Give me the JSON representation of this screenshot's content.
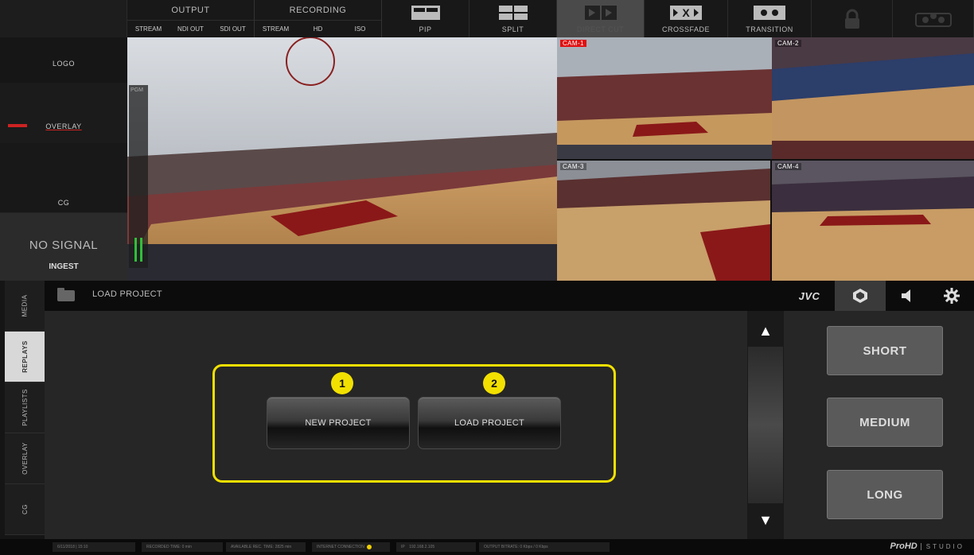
{
  "topbar": {
    "output": {
      "title": "OUTPUT",
      "items": [
        "STREAM",
        "NDI OUT",
        "SDI OUT"
      ]
    },
    "recording": {
      "title": "RECORDING",
      "items": [
        "STREAM",
        "HD",
        "ISO"
      ]
    },
    "modes": [
      "PIP",
      "SPLIT",
      "DIRECT CUT",
      "CROSSFADE",
      "TRANSITION"
    ],
    "active_mode": "DIRECT CUT"
  },
  "sources": {
    "logo": "LOGO",
    "overlay": "OVERLAY",
    "cg": "CG",
    "no_signal": "NO SIGNAL",
    "ingest": "INGEST"
  },
  "program": {
    "meter_label": "PGM"
  },
  "cams": [
    "CAM-1",
    "CAM-2",
    "CAM-3",
    "CAM-4"
  ],
  "left_tabs": [
    "MEDIA",
    "REPLAYS",
    "PLAYLISTS",
    "OVERLAY",
    "CG"
  ],
  "active_left_tab": "REPLAYS",
  "subbar": {
    "title": "LOAD PROJECT"
  },
  "workspace": {
    "new_project": "NEW PROJECT",
    "load_project": "LOAD PROJECT",
    "marker_1": "1",
    "marker_2": "2"
  },
  "right_tabs": {
    "jvc": "JVC"
  },
  "replay_length": [
    "SHORT",
    "MEDIUM",
    "LONG"
  ],
  "status": {
    "date": "6/11/2018 | 15:10",
    "recorded": "RECORDED TIME: 0 min",
    "available": "AVAILABLE REC. TIME: 2825 min",
    "internet": "INTERNET CONNECTION",
    "ip_label": "IP",
    "ip": "192.168.2.105",
    "bitrate": "OUTPUT BITRATE: 0 Kbps / 0 Kbps"
  },
  "brand": {
    "name": "ProHD",
    "sub": "STUDIO"
  },
  "colors": {
    "highlight": "#f2e000",
    "live": "#e01010",
    "meter": "#2fbf3a"
  }
}
